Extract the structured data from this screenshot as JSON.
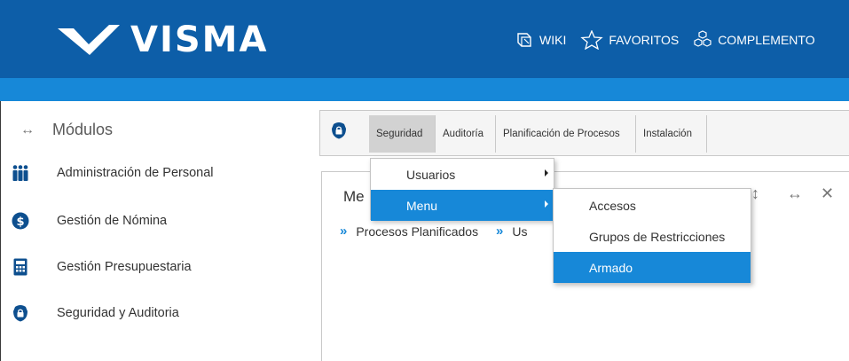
{
  "header": {
    "logo_text": "VISMA",
    "nav": [
      {
        "label": "WIKI",
        "icon": "book-icon"
      },
      {
        "label": "FAVORITOS",
        "icon": "star-icon"
      },
      {
        "label": "COMPLEMENTO",
        "icon": "cubes-icon"
      }
    ]
  },
  "sidebar": {
    "title": "Módulos",
    "items": [
      {
        "label": "Administración de Personal",
        "icon": "people-icon"
      },
      {
        "label": "Gestión de Nómina",
        "icon": "dollar-icon"
      },
      {
        "label": "Gestión Presupuestaria",
        "icon": "calculator-icon"
      },
      {
        "label": "Seguridad y Auditoria",
        "icon": "lock-icon"
      }
    ]
  },
  "tabs": [
    "Seguridad",
    "Auditoría",
    "Planificación de Procesos",
    "Instalación"
  ],
  "panel": {
    "title": "Me",
    "links": [
      "Procesos Planificados",
      "Us"
    ]
  },
  "menu_level1": [
    {
      "label": "Usuarios",
      "selected": false
    },
    {
      "label": "Menu",
      "selected": true
    }
  ],
  "menu_level2": [
    {
      "label": "Accesos",
      "selected": false
    },
    {
      "label": "Grupos de Restricciones",
      "selected": false
    },
    {
      "label": "Armado",
      "selected": true
    }
  ],
  "colors": {
    "header": "#0d5ea8",
    "accent": "#1788d8",
    "icon": "#0d4f8f"
  }
}
